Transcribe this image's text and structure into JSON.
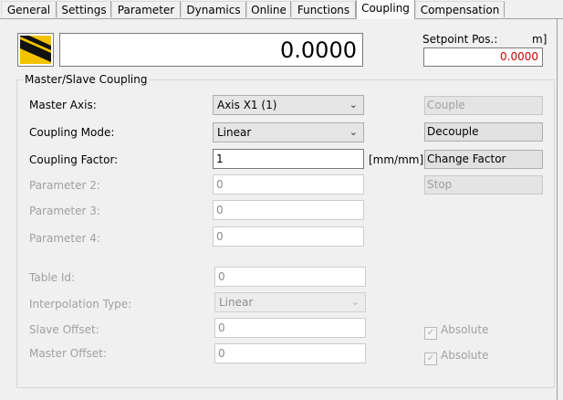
{
  "tabs": [
    {
      "label": "General",
      "active": false
    },
    {
      "label": "Settings",
      "active": false
    },
    {
      "label": "Parameter",
      "active": false
    },
    {
      "label": "Dynamics",
      "active": false
    },
    {
      "label": "Online",
      "active": false
    },
    {
      "label": "Functions",
      "active": false
    },
    {
      "label": "Coupling",
      "active": true
    },
    {
      "label": "Compensation",
      "active": false
    }
  ],
  "display": {
    "value": "0.0000",
    "icon": "axis-icon"
  },
  "setpoint": {
    "label": "Setpoint Pos.:",
    "unit": "m]",
    "value": "0.0000",
    "value_color": "#d00000"
  },
  "group": {
    "title": "Master/Slave Coupling"
  },
  "master_axis": {
    "label": "Master Axis:",
    "value": "Axis X1 (1)"
  },
  "coupling_mode": {
    "label": "Coupling Mode:",
    "value": "Linear"
  },
  "coupling_factor": {
    "label": "Coupling Factor:",
    "value": "1",
    "unit": "[mm/mm]"
  },
  "parameter2": {
    "label": "Parameter 2:",
    "value": "0"
  },
  "parameter3": {
    "label": "Parameter 3:",
    "value": "0"
  },
  "parameter4": {
    "label": "Parameter 4:",
    "value": "0"
  },
  "table_id": {
    "label": "Table Id:",
    "value": "0"
  },
  "interpolation_type": {
    "label": "Interpolation Type:",
    "value": "Linear"
  },
  "slave_offset": {
    "label": "Slave Offset:",
    "value": "0",
    "absolute_label": "Absolute",
    "absolute_checked": true
  },
  "master_offset": {
    "label": "Master Offset:",
    "value": "0",
    "absolute_label": "Absolute",
    "absolute_checked": true
  },
  "buttons": {
    "couple": "Couple",
    "decouple": "Decouple",
    "change_factor": "Change Factor",
    "stop": "Stop"
  }
}
